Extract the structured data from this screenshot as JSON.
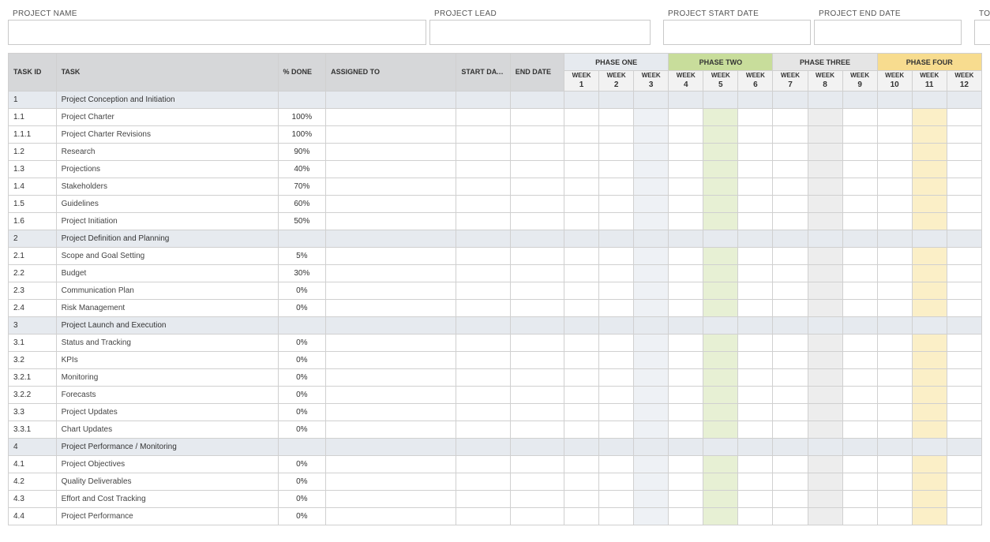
{
  "header": {
    "project_name_label": "PROJECT NAME",
    "project_lead_label": "PROJECT LEAD",
    "project_start_label": "PROJECT START DATE",
    "project_end_label": "PROJECT END DATE",
    "today_label": "TODAY'S DATE",
    "project_name": "",
    "project_lead": "",
    "project_start": "",
    "project_end": "",
    "today": ""
  },
  "phases": [
    {
      "label": "PHASE ONE",
      "weeks": [
        1,
        2,
        3
      ]
    },
    {
      "label": "PHASE TWO",
      "weeks": [
        4,
        5,
        6
      ]
    },
    {
      "label": "PHASE THREE",
      "weeks": [
        7,
        8,
        9
      ]
    },
    {
      "label": "PHASE FOUR",
      "weeks": [
        10,
        11,
        12
      ]
    }
  ],
  "columns": {
    "task_id": "TASK ID",
    "task": "TASK",
    "pct_done": "% DONE",
    "assigned_to": "ASSIGNED TO",
    "start_date": "START DATE",
    "end_date": "END DATE",
    "week_prefix": "WEEK"
  },
  "rows": [
    {
      "id": "1",
      "task": "Project Conception and Initiation",
      "pct": "",
      "section": true
    },
    {
      "id": "1.1",
      "task": "Project Charter",
      "pct": "100%",
      "section": false
    },
    {
      "id": "1.1.1",
      "task": "Project Charter Revisions",
      "pct": "100%",
      "section": false
    },
    {
      "id": "1.2",
      "task": "Research",
      "pct": "90%",
      "section": false
    },
    {
      "id": "1.3",
      "task": "Projections",
      "pct": "40%",
      "section": false
    },
    {
      "id": "1.4",
      "task": "Stakeholders",
      "pct": "70%",
      "section": false
    },
    {
      "id": "1.5",
      "task": "Guidelines",
      "pct": "60%",
      "section": false
    },
    {
      "id": "1.6",
      "task": "Project Initiation",
      "pct": "50%",
      "section": false
    },
    {
      "id": "2",
      "task": "Project Definition and Planning",
      "pct": "",
      "section": true
    },
    {
      "id": "2.1",
      "task": "Scope and Goal Setting",
      "pct": "5%",
      "section": false
    },
    {
      "id": "2.2",
      "task": "Budget",
      "pct": "30%",
      "section": false
    },
    {
      "id": "2.3",
      "task": "Communication Plan",
      "pct": "0%",
      "section": false
    },
    {
      "id": "2.4",
      "task": "Risk Management",
      "pct": "0%",
      "section": false
    },
    {
      "id": "3",
      "task": "Project Launch and Execution",
      "pct": "",
      "section": true
    },
    {
      "id": "3.1",
      "task": "Status and Tracking",
      "pct": "0%",
      "section": false
    },
    {
      "id": "3.2",
      "task": "KPIs",
      "pct": "0%",
      "section": false
    },
    {
      "id": "3.2.1",
      "task": "Monitoring",
      "pct": "0%",
      "section": false
    },
    {
      "id": "3.2.2",
      "task": "Forecasts",
      "pct": "0%",
      "section": false
    },
    {
      "id": "3.3",
      "task": "Project Updates",
      "pct": "0%",
      "section": false
    },
    {
      "id": "3.3.1",
      "task": "Chart Updates",
      "pct": "0%",
      "section": false
    },
    {
      "id": "4",
      "task": "Project Performance / Monitoring",
      "pct": "",
      "section": true
    },
    {
      "id": "4.1",
      "task": "Project Objectives",
      "pct": "0%",
      "section": false
    },
    {
      "id": "4.2",
      "task": "Quality Deliverables",
      "pct": "0%",
      "section": false
    },
    {
      "id": "4.3",
      "task": "Effort and Cost Tracking",
      "pct": "0%",
      "section": false
    },
    {
      "id": "4.4",
      "task": "Project Performance",
      "pct": "0%",
      "section": false
    }
  ],
  "highlight_week_cols": {
    "phase1": 3,
    "phase2": 5,
    "phase3": 8,
    "phase4": 11
  }
}
